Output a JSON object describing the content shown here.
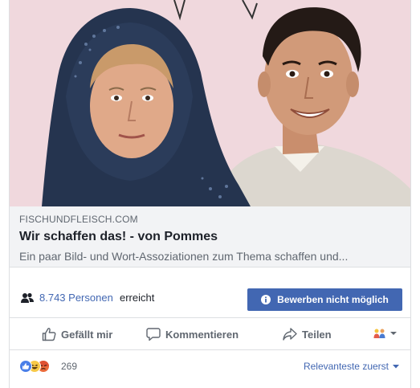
{
  "link_preview": {
    "domain": "FISCHUNDFLEISCH.COM",
    "title": "Wir schaffen das! - von Pommes",
    "description": "Ein paar Bild- und Wort-Assoziationen zum Thema schaffen und..."
  },
  "reach": {
    "count_text": "8.743 Personen",
    "suffix": "erreicht",
    "icon": "people-icon"
  },
  "boost": {
    "label": "Bewerben nicht möglich",
    "icon": "info-icon"
  },
  "actions": {
    "like": {
      "label": "Gefällt mir",
      "icon": "thumbs-up-icon"
    },
    "comment": {
      "label": "Kommentieren",
      "icon": "speech-bubble-icon"
    },
    "share": {
      "label": "Teilen",
      "icon": "share-arrow-icon"
    },
    "audience": {
      "icon": "friends-icon"
    }
  },
  "reactions": {
    "types": [
      "like",
      "haha",
      "angry"
    ],
    "count": "269",
    "sort_label": "Relevanteste zuerst"
  },
  "colors": {
    "accent": "#4267b2",
    "secondary_text": "#606770",
    "preview_background": "#f0d7dc",
    "meta_background": "#f2f3f5"
  }
}
